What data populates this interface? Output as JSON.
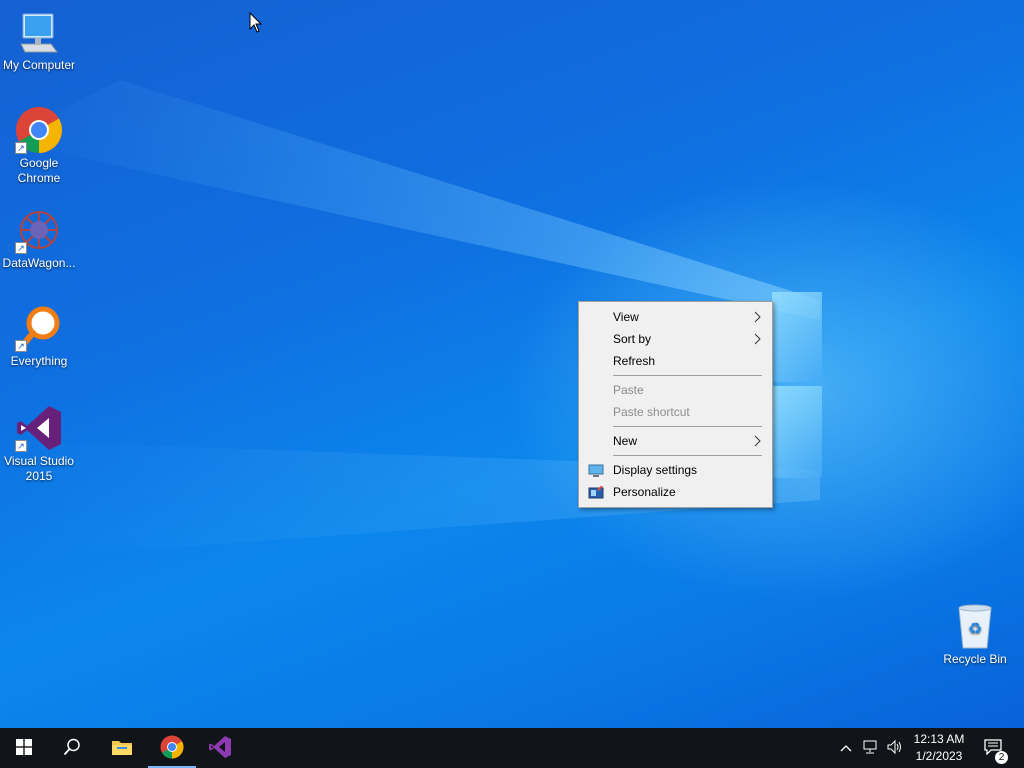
{
  "desktop": {
    "icons": [
      {
        "label": "My Computer",
        "icon": "monitor-icon"
      },
      {
        "label": "Google Chrome",
        "icon": "chrome-icon"
      },
      {
        "label": "DataWagon...",
        "icon": "datawagon-icon"
      },
      {
        "label": "Everything",
        "icon": "magnifier-icon"
      },
      {
        "label": "Visual Studio 2015",
        "icon": "visual-studio-icon"
      },
      {
        "label": "Recycle Bin",
        "icon": "recycle-bin-icon"
      }
    ]
  },
  "context_menu": {
    "items": [
      {
        "label": "View",
        "submenu": true,
        "enabled": true
      },
      {
        "label": "Sort by",
        "submenu": true,
        "enabled": true
      },
      {
        "label": "Refresh",
        "submenu": false,
        "enabled": true
      },
      {
        "label": "Paste",
        "submenu": false,
        "enabled": false
      },
      {
        "label": "Paste shortcut",
        "submenu": false,
        "enabled": false
      },
      {
        "label": "New",
        "submenu": true,
        "enabled": true
      },
      {
        "label": "Display settings",
        "submenu": false,
        "enabled": true,
        "icon": "display-icon"
      },
      {
        "label": "Personalize",
        "submenu": false,
        "enabled": true,
        "icon": "personalize-icon"
      }
    ]
  },
  "taskbar": {
    "buttons": [
      "start-icon",
      "search-icon",
      "file-explorer-icon",
      "chrome-icon",
      "visual-studio-icon"
    ],
    "tray": {
      "time": "12:13 AM",
      "date": "1/2/2023",
      "notification_count": "2"
    }
  },
  "colors": {
    "accent": "#77b7f5",
    "taskbar": "#111519",
    "menu_bg": "#f0f0f0"
  }
}
